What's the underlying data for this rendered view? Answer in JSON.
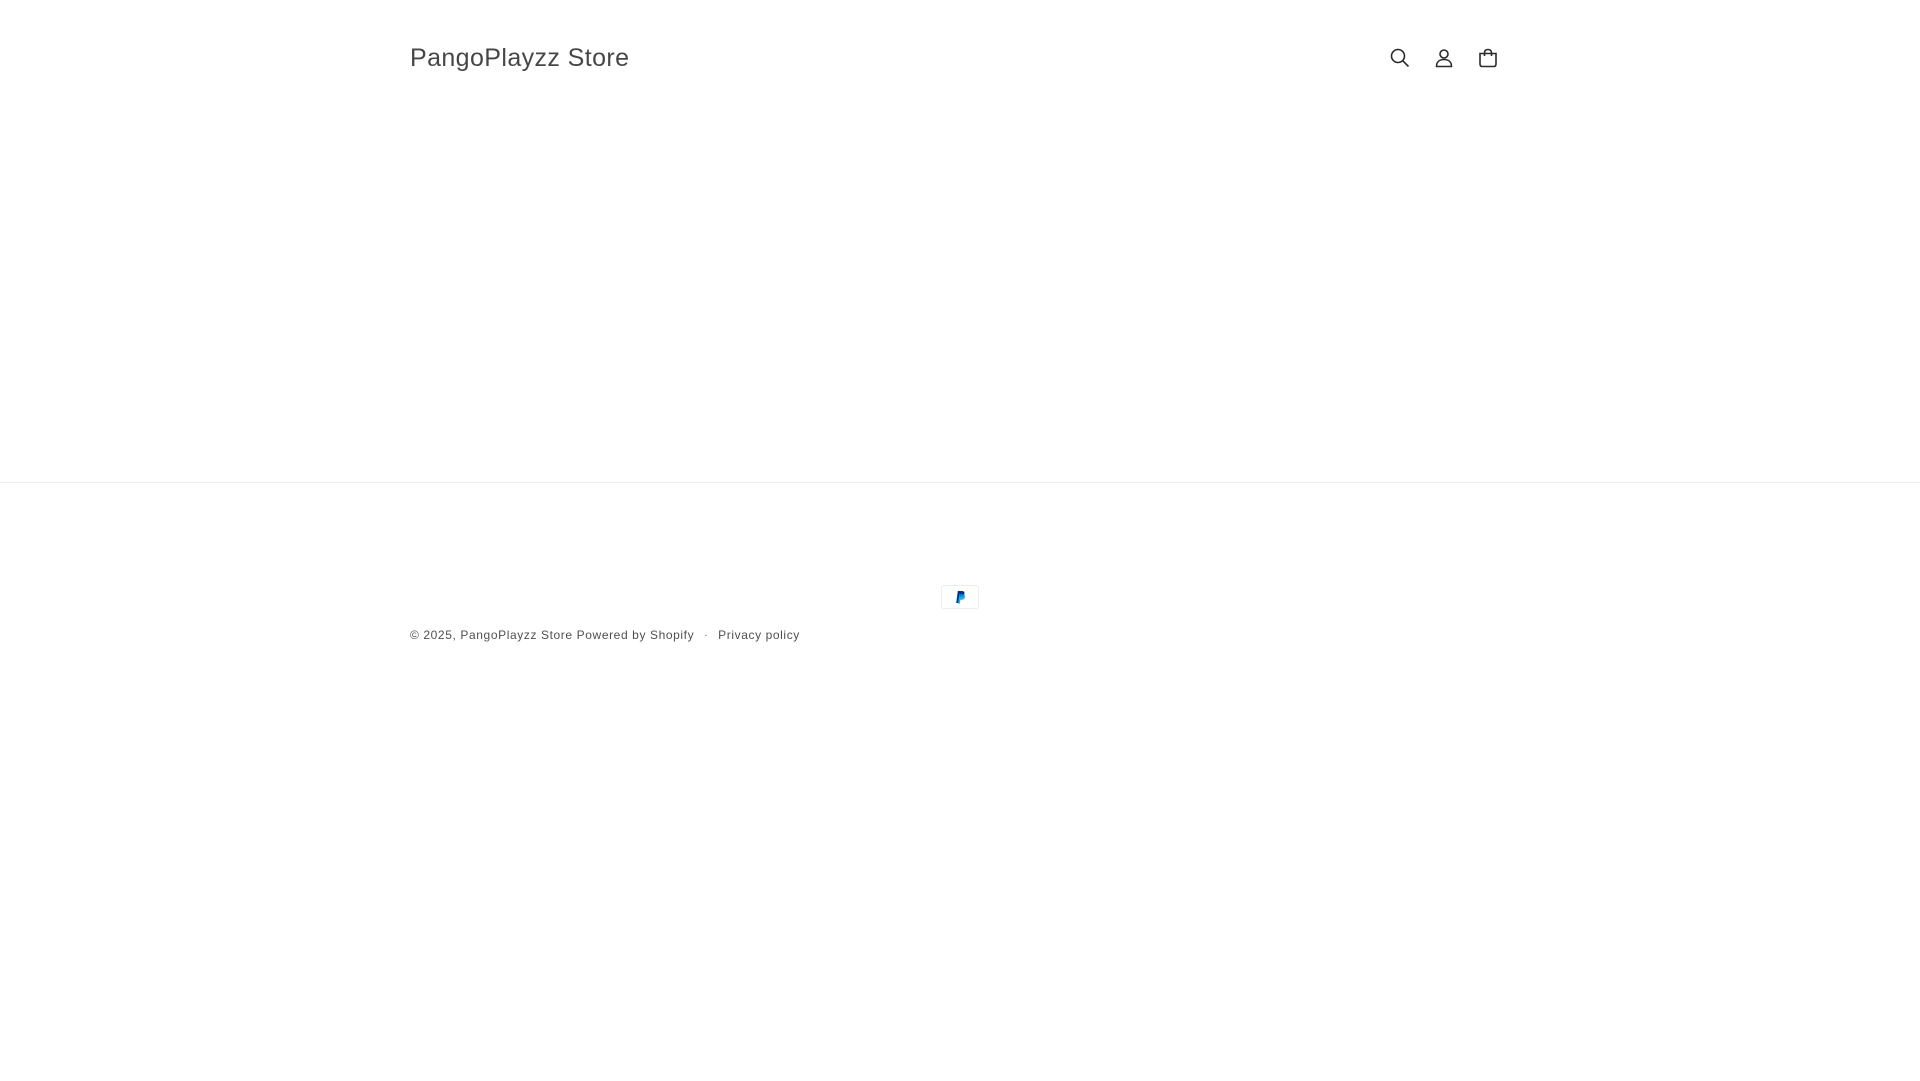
{
  "header": {
    "store_name": "PangoPlayzz Store",
    "icons": [
      "search-icon",
      "account-icon",
      "cart-icon"
    ]
  },
  "footer": {
    "payment_method": "PayPal",
    "copyright_prefix": "© 2025,",
    "store_link": "PangoPlayzz Store",
    "powered_by": "Powered by Shopify",
    "separator": "·",
    "privacy_policy": "Privacy policy"
  },
  "colors": {
    "text": "#121212",
    "paypal_dark": "#003087",
    "paypal_light": "#009cde",
    "border": "#ebebeb"
  }
}
